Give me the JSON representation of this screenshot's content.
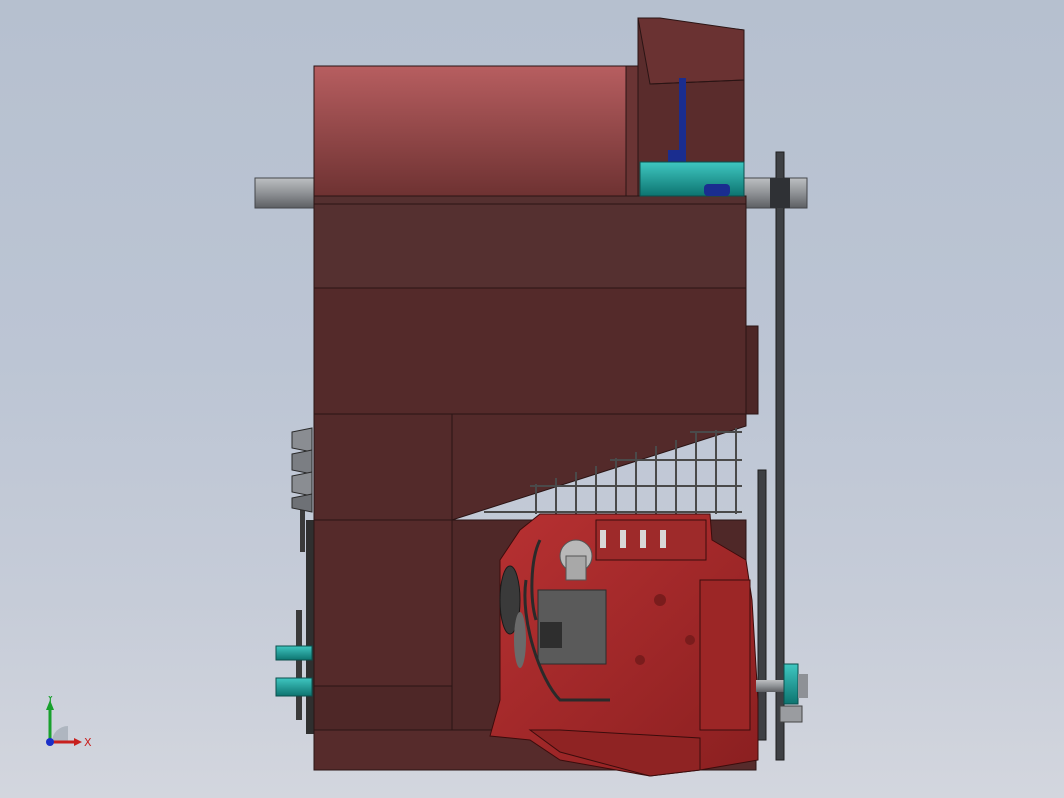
{
  "view": {
    "background_top": "#b6c0cf",
    "background_bottom": "#d3d6de"
  },
  "model": {
    "housing_color": "#532a2a",
    "housing_highlight": "#a9585a",
    "engine_color": "#a8282a",
    "engine_dark": "#6e1c1c",
    "shaft_color": "#8e9196",
    "cyan_part_color": "#149e9a",
    "blue_bracket_color": "#1a2d8f",
    "grid_color": "#3b3b3b",
    "ecu_color": "#5a5a5a"
  },
  "triad": {
    "x_label": "X",
    "y_label": "Y",
    "x_color": "#c8201e",
    "y_color": "#18a02c",
    "z_color": "#1b2fc8"
  }
}
